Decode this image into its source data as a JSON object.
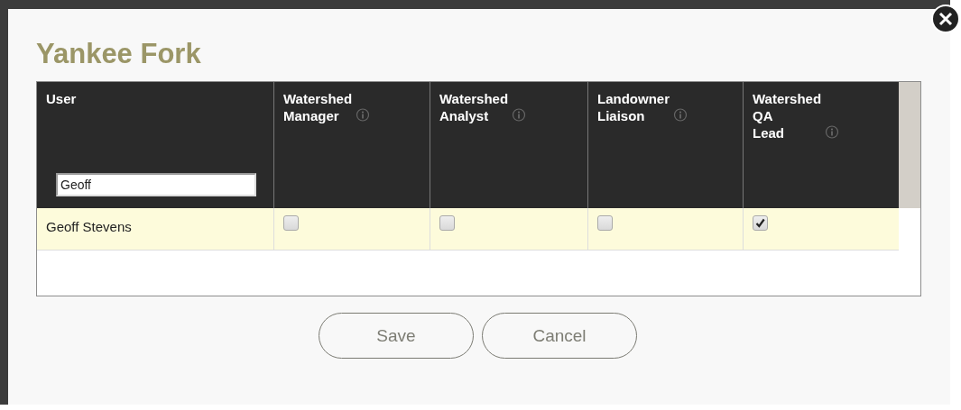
{
  "dialog": {
    "title": "Yankee Fork"
  },
  "table": {
    "columns": [
      {
        "label": "User",
        "info": false,
        "filter": {
          "value": "Geoff"
        }
      },
      {
        "label": "Watershed\nManager",
        "info": true
      },
      {
        "label": "Watershed\nAnalyst",
        "info": true
      },
      {
        "label": "Landowner\nLiaison",
        "info": true
      },
      {
        "label": "Watershed\nQA\nLead",
        "info": true
      }
    ],
    "rows": [
      {
        "user": "Geoff Stevens",
        "roles": [
          {
            "checked": false
          },
          {
            "checked": false
          },
          {
            "checked": false
          },
          {
            "checked": true
          }
        ]
      }
    ]
  },
  "buttons": [
    {
      "label": "Save"
    },
    {
      "label": "Cancel"
    }
  ]
}
